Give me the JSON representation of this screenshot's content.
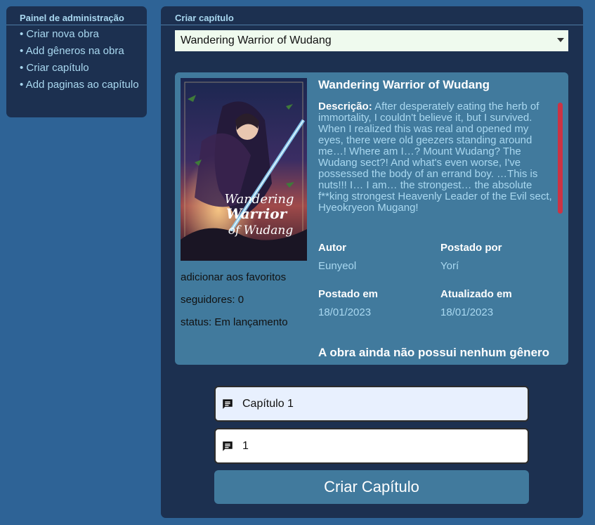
{
  "sidebar": {
    "title": "Painel de administração",
    "items": [
      {
        "label": "• Criar nova obra"
      },
      {
        "label": "• Add gêneros na obra"
      },
      {
        "label": "• Criar capítulo"
      },
      {
        "label": "• Add paginas ao capítulo"
      }
    ]
  },
  "main": {
    "title": "Criar capítulo",
    "select": {
      "value": "Wandering Warrior of Wudang"
    }
  },
  "work": {
    "title": "Wandering Warrior of Wudang",
    "cover_text_line1": "Wandering",
    "cover_text_line2": "Warrior",
    "cover_text_line3": "of Wudang",
    "description_label": "Descrição:",
    "description": "After desperately eating the herb of immortality, I couldn't believe it, but I survived. When I realized this was real and opened my eyes, there were old geezers standing around me…! Where am I…? Mount Wudang? The Wudang sect?! And what's even worse, I've possessed the body of an errand boy. …This is nuts!!! I… I am… the strongest… the absolute f**king strongest Heavenly Leader of the Evil sect, Hyeokryeon Mugang!",
    "favorite_label": "adicionar aos favoritos",
    "followers_label": "seguidores: 0",
    "status_label": "status: Em lançamento",
    "author_label": "Autor",
    "author": "Eunyeol",
    "posted_by_label": "Postado por",
    "posted_by": "Yorí",
    "posted_at_label": "Postado em",
    "posted_at": "18/01/2023",
    "updated_at_label": "Atualizado em",
    "updated_at": "18/01/2023",
    "no_genre": "A obra ainda não possui nenhum gênero"
  },
  "form": {
    "chapter_title_value": "Capítulo 1",
    "chapter_number_value": "1",
    "submit_label": "Criar Capítulo"
  },
  "colors": {
    "background": "#2e6396",
    "panel": "#1c3050",
    "card": "#417a9d",
    "accent_text": "#a9d8f0",
    "scrollbar": "#cc3344"
  }
}
